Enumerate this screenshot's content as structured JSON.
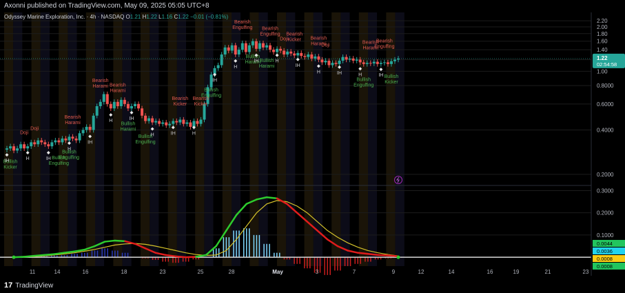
{
  "header": {
    "published": "Axonni published on TradingView.com, May 09, 2025 05:05 UTC+8"
  },
  "legend": {
    "symbol": "Odyssey Marine Exploration, Inc. · 4h · NASDAQ",
    "open_label": "O",
    "open": "1.21",
    "high_label": "H",
    "high": "1.22",
    "low_label": "L",
    "low": "1.16",
    "close_label": "C",
    "close": "1.22",
    "change": "−0.01 (−0.81%)"
  },
  "price_badge": {
    "value": "1.22",
    "countdown": "02:54:58"
  },
  "indicator_badges": [
    "0.0044",
    "0.0036",
    "0.0008",
    "0.0008"
  ],
  "footer": {
    "brand": "TradingView"
  },
  "colors": {
    "up": "#26a69a",
    "down": "#ef5350",
    "pattern_bear": "#e05a4f",
    "pattern_bull": "#4caf50",
    "osc_green": "#2ecc2e",
    "osc_red": "#e01c1c",
    "osc_yellow": "#d4c22a",
    "badge_green": "#22c55e",
    "badge_cyan": "#22d3ee",
    "badge_yellow": "#facc15"
  },
  "chart_data": [
    {
      "type": "candlestick",
      "y_scale": "log",
      "ylim": [
        0.17,
        2.3
      ],
      "y_ticks": [
        "2.20",
        "2.00",
        "1.80",
        "1.60",
        "1.40",
        "1.20",
        "1.00",
        "0.8000",
        "0.6000",
        "0.4000",
        "0.2000"
      ],
      "x_ticks": [
        "11",
        "14",
        "16",
        "18",
        "23",
        "25",
        "28",
        "May",
        "3",
        "7",
        "9",
        "12",
        "14",
        "16",
        "19",
        "21",
        "23"
      ],
      "closes": [
        0.3,
        0.31,
        0.29,
        0.3,
        0.32,
        0.3,
        0.31,
        0.33,
        0.32,
        0.34,
        0.33,
        0.32,
        0.31,
        0.33,
        0.34,
        0.33,
        0.35,
        0.34,
        0.36,
        0.35,
        0.34,
        0.38,
        0.4,
        0.42,
        0.4,
        0.5,
        0.58,
        0.62,
        0.7,
        0.6,
        0.56,
        0.62,
        0.58,
        0.64,
        0.6,
        0.56,
        0.58,
        0.6,
        0.56,
        0.5,
        0.46,
        0.48,
        0.45,
        0.46,
        0.44,
        0.45,
        0.43,
        0.44,
        0.46,
        0.45,
        0.47,
        0.44,
        0.45,
        0.42,
        0.46,
        0.44,
        0.47,
        0.6,
        0.78,
        0.95,
        1.05,
        1.1,
        1.3,
        1.45,
        1.38,
        1.5,
        1.3,
        1.4,
        1.55,
        1.35,
        1.5,
        1.6,
        1.42,
        1.55,
        1.45,
        1.5,
        1.4,
        1.35,
        1.42,
        1.38,
        1.3,
        1.36,
        1.32,
        1.28,
        1.33,
        1.27,
        1.25,
        1.3,
        1.22,
        1.26,
        1.2,
        1.15,
        1.18,
        1.1,
        1.14,
        1.12,
        1.18,
        1.25,
        1.2,
        1.22,
        1.18,
        1.2,
        1.15,
        1.12,
        1.14,
        1.13,
        1.16,
        1.12,
        1.14,
        1.15,
        1.12,
        1.17,
        1.2,
        1.22
      ],
      "last": "1.22",
      "patterns": [
        {
          "label": "Bullish Kicker",
          "kind": "bull",
          "at": 1
        },
        {
          "label": "Doji",
          "kind": "bear",
          "at": 4
        },
        {
          "label": "Doji",
          "kind": "bear",
          "at": 7
        },
        {
          "label": "Bullish Engulfing",
          "kind": "bull",
          "at": 13
        },
        {
          "label": "Bullish Engulfing",
          "kind": "bull",
          "at": 16
        },
        {
          "label": "Bearish Harami",
          "kind": "bear",
          "at": 17
        },
        {
          "label": "Bearish Harami",
          "kind": "bear",
          "at": 24
        },
        {
          "label": "Bearish Harami",
          "kind": "bear",
          "at": 28
        },
        {
          "label": "Bullish Harami",
          "kind": "bull",
          "at": 31
        },
        {
          "label": "Bullish Engulfing",
          "kind": "bull",
          "at": 35
        },
        {
          "label": "Bearish Kicker",
          "kind": "bear",
          "at": 44
        },
        {
          "label": "Bearish Kicker",
          "kind": "bear",
          "at": 49
        },
        {
          "label": "Bullish Engulfing",
          "kind": "bull",
          "at": 52
        },
        {
          "label": "Bearish Engulfing",
          "kind": "bear",
          "at": 60
        },
        {
          "label": "Bullish Harami",
          "kind": "bull",
          "at": 62
        },
        {
          "label": "Bullish Harami",
          "kind": "bull",
          "at": 66
        },
        {
          "label": "Bearish Engulfing",
          "kind": "bear",
          "at": 67
        },
        {
          "label": "Doji",
          "kind": "bear",
          "at": 70
        },
        {
          "label": "Bearish Kicker",
          "kind": "bear",
          "at": 73
        },
        {
          "label": "Bearish Harami",
          "kind": "bear",
          "at": 79
        },
        {
          "label": "Doji",
          "kind": "bear",
          "at": 81
        },
        {
          "label": "Bullish Engulfing",
          "kind": "bull",
          "at": 90
        },
        {
          "label": "Bearish Harami",
          "kind": "bear",
          "at": 92
        },
        {
          "label": "Bearish Engulfing",
          "kind": "bear",
          "at": 96
        },
        {
          "label": "Bullish Kicker",
          "kind": "bull",
          "at": 97
        }
      ],
      "markers": [
        "H",
        "IH"
      ]
    },
    {
      "type": "oscillator",
      "ylim": [
        -0.04,
        0.32
      ],
      "y_ticks": [
        "0.3000",
        "0.2000",
        "0.1000"
      ],
      "fast_line": [
        0.0,
        0.002,
        0.006,
        0.01,
        0.014,
        0.02,
        0.026,
        0.034,
        0.05,
        0.07,
        0.075,
        0.072,
        0.06,
        0.04,
        0.02,
        0.01,
        0.004,
        0.0,
        0.002,
        0.01,
        0.05,
        0.12,
        0.19,
        0.24,
        0.26,
        0.27,
        0.265,
        0.24,
        0.2,
        0.16,
        0.12,
        0.08,
        0.05,
        0.03,
        0.02,
        0.015,
        0.01,
        0.008,
        0.004
      ],
      "slow_line": [
        0.0,
        0.001,
        0.003,
        0.006,
        0.01,
        0.015,
        0.02,
        0.027,
        0.035,
        0.045,
        0.055,
        0.06,
        0.062,
        0.058,
        0.05,
        0.04,
        0.03,
        0.02,
        0.012,
        0.008,
        0.01,
        0.03,
        0.08,
        0.14,
        0.2,
        0.24,
        0.255,
        0.25,
        0.23,
        0.2,
        0.16,
        0.12,
        0.09,
        0.065,
        0.045,
        0.03,
        0.02,
        0.012,
        0.006
      ],
      "histogram": [
        0.0,
        0.002,
        0.003,
        0.005,
        0.008,
        0.01,
        0.015,
        0.02,
        0.03,
        0.04,
        0.03,
        0.02,
        0.0,
        -0.005,
        -0.012,
        -0.02,
        -0.025,
        -0.02,
        -0.01,
        0.002,
        0.04,
        0.09,
        0.12,
        0.13,
        0.1,
        0.06,
        0.02,
        -0.01,
        -0.03,
        -0.05,
        -0.07,
        -0.08,
        -0.06,
        -0.04,
        -0.03,
        -0.02,
        -0.01,
        -0.005,
        -0.002
      ]
    }
  ]
}
